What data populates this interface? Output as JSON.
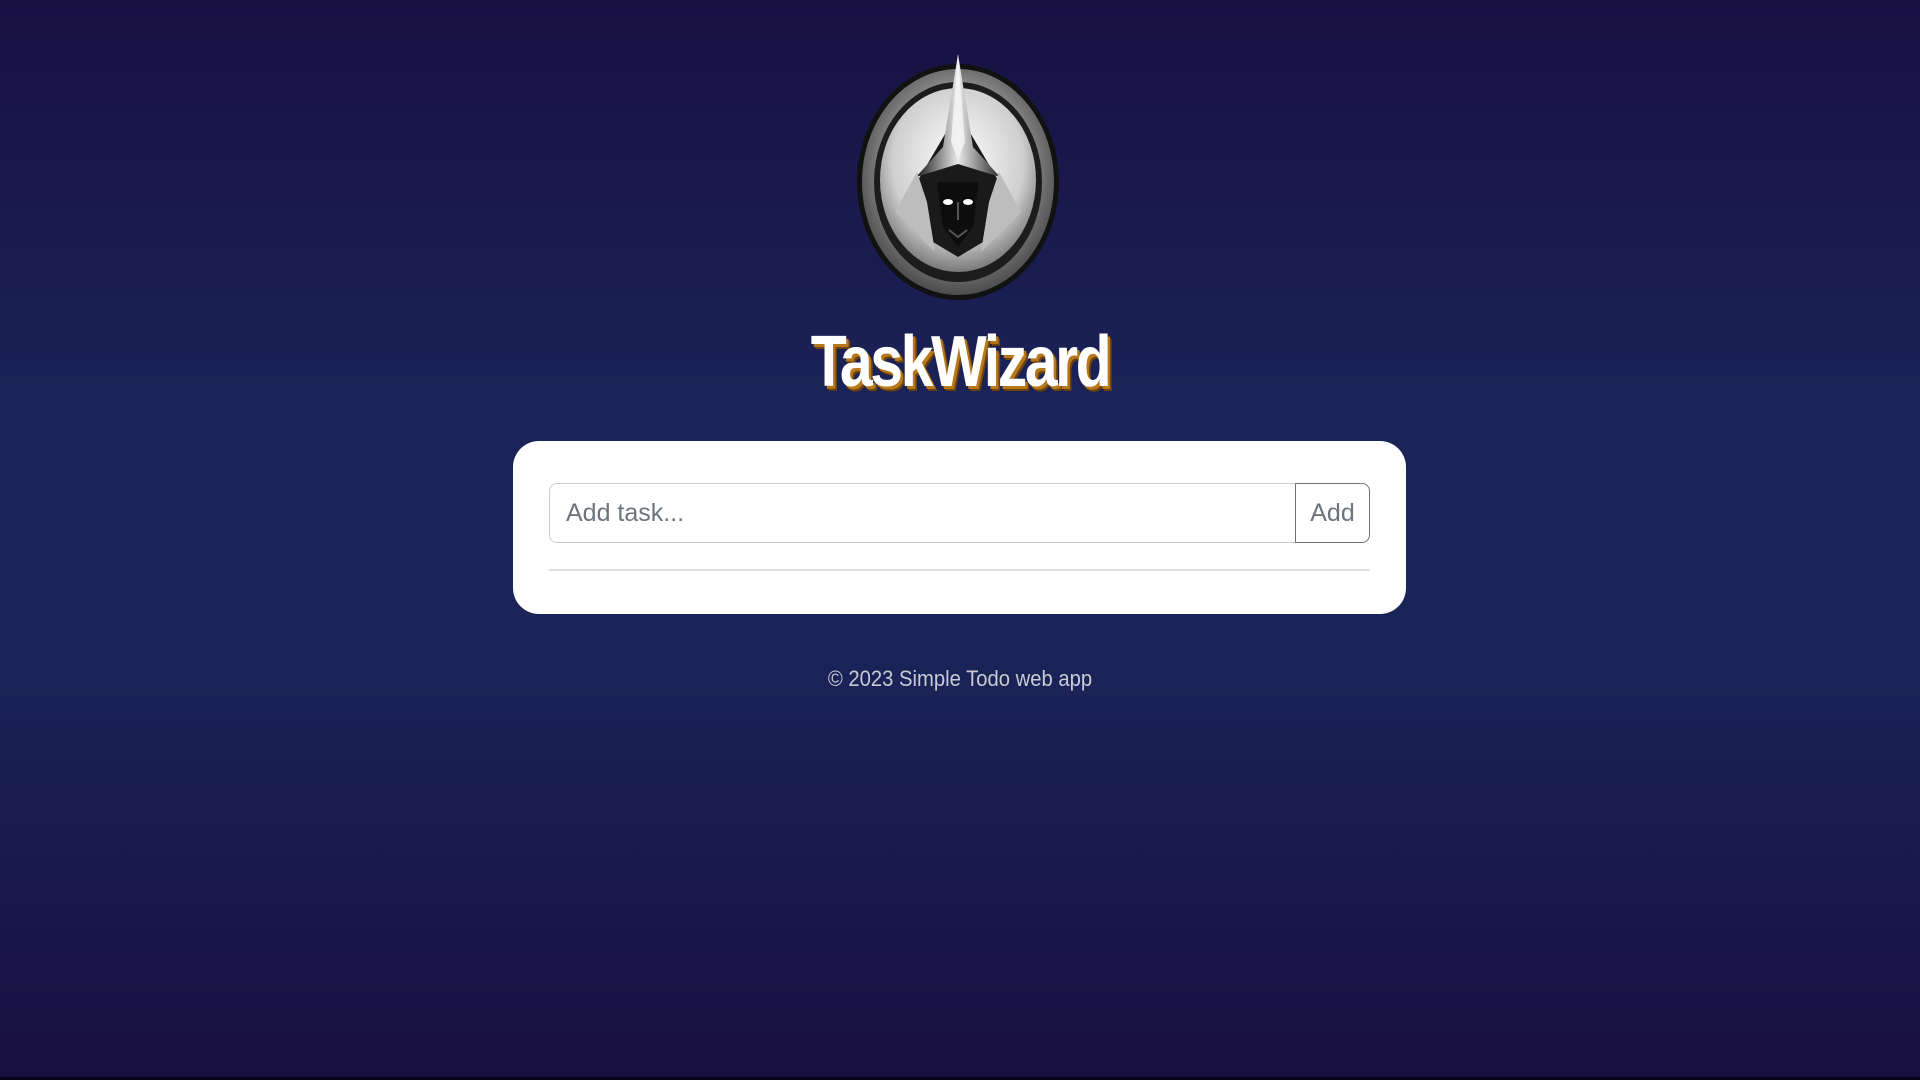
{
  "app": {
    "title": "TaskWizard",
    "logo_icon": "wizard-logo-icon"
  },
  "task_form": {
    "input_value": "",
    "input_placeholder": "Add task...",
    "add_button_label": "Add"
  },
  "tasks": [],
  "footer": {
    "text": "© 2023 Simple Todo web app"
  },
  "colors": {
    "background_top": "#181041",
    "background_mid": "#1a2459",
    "title_shadow": "#b8781a",
    "card": "#ffffff",
    "button_text": "#6c757d"
  }
}
